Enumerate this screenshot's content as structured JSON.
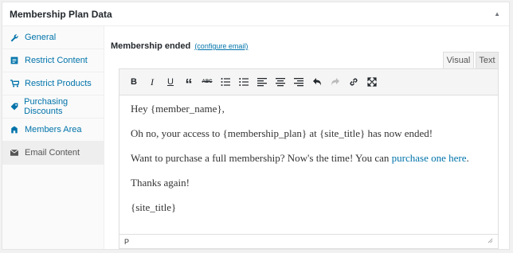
{
  "metabox": {
    "title": "Membership Plan Data",
    "toggle_icon": "▲"
  },
  "sidebar": {
    "items": [
      {
        "label": "General",
        "icon": "wrench-icon",
        "glyph": "🔧"
      },
      {
        "label": "Restrict Content",
        "icon": "content-icon",
        "glyph": "▤"
      },
      {
        "label": "Restrict Products",
        "icon": "cart-icon",
        "glyph": "🛒"
      },
      {
        "label": "Purchasing Discounts",
        "icon": "tag-icon",
        "glyph": "◆"
      },
      {
        "label": "Members Area",
        "icon": "building-icon",
        "glyph": "▙"
      },
      {
        "label": "Email Content",
        "icon": "email-icon",
        "glyph": "✉",
        "active": true
      }
    ]
  },
  "field": {
    "label": "Membership ended",
    "link": "(configure email)"
  },
  "tabs": {
    "visual": "Visual",
    "text": "Text"
  },
  "toolbar": {
    "bold": "B",
    "italic": "I",
    "underline": "U",
    "quote": "“",
    "strike": "ABC"
  },
  "content": {
    "p1": "Hey {member_name},",
    "p2": "Oh no, your access to {membership_plan} at {site_title} has now ended!",
    "p3_before": "Want to purchase a full membership? Now's the time! You can ",
    "p3_link": "purchase one here",
    "p3_after": ".",
    "p4": "Thanks again!",
    "p5": "{site_title}"
  },
  "statusbar": {
    "path": "P"
  }
}
